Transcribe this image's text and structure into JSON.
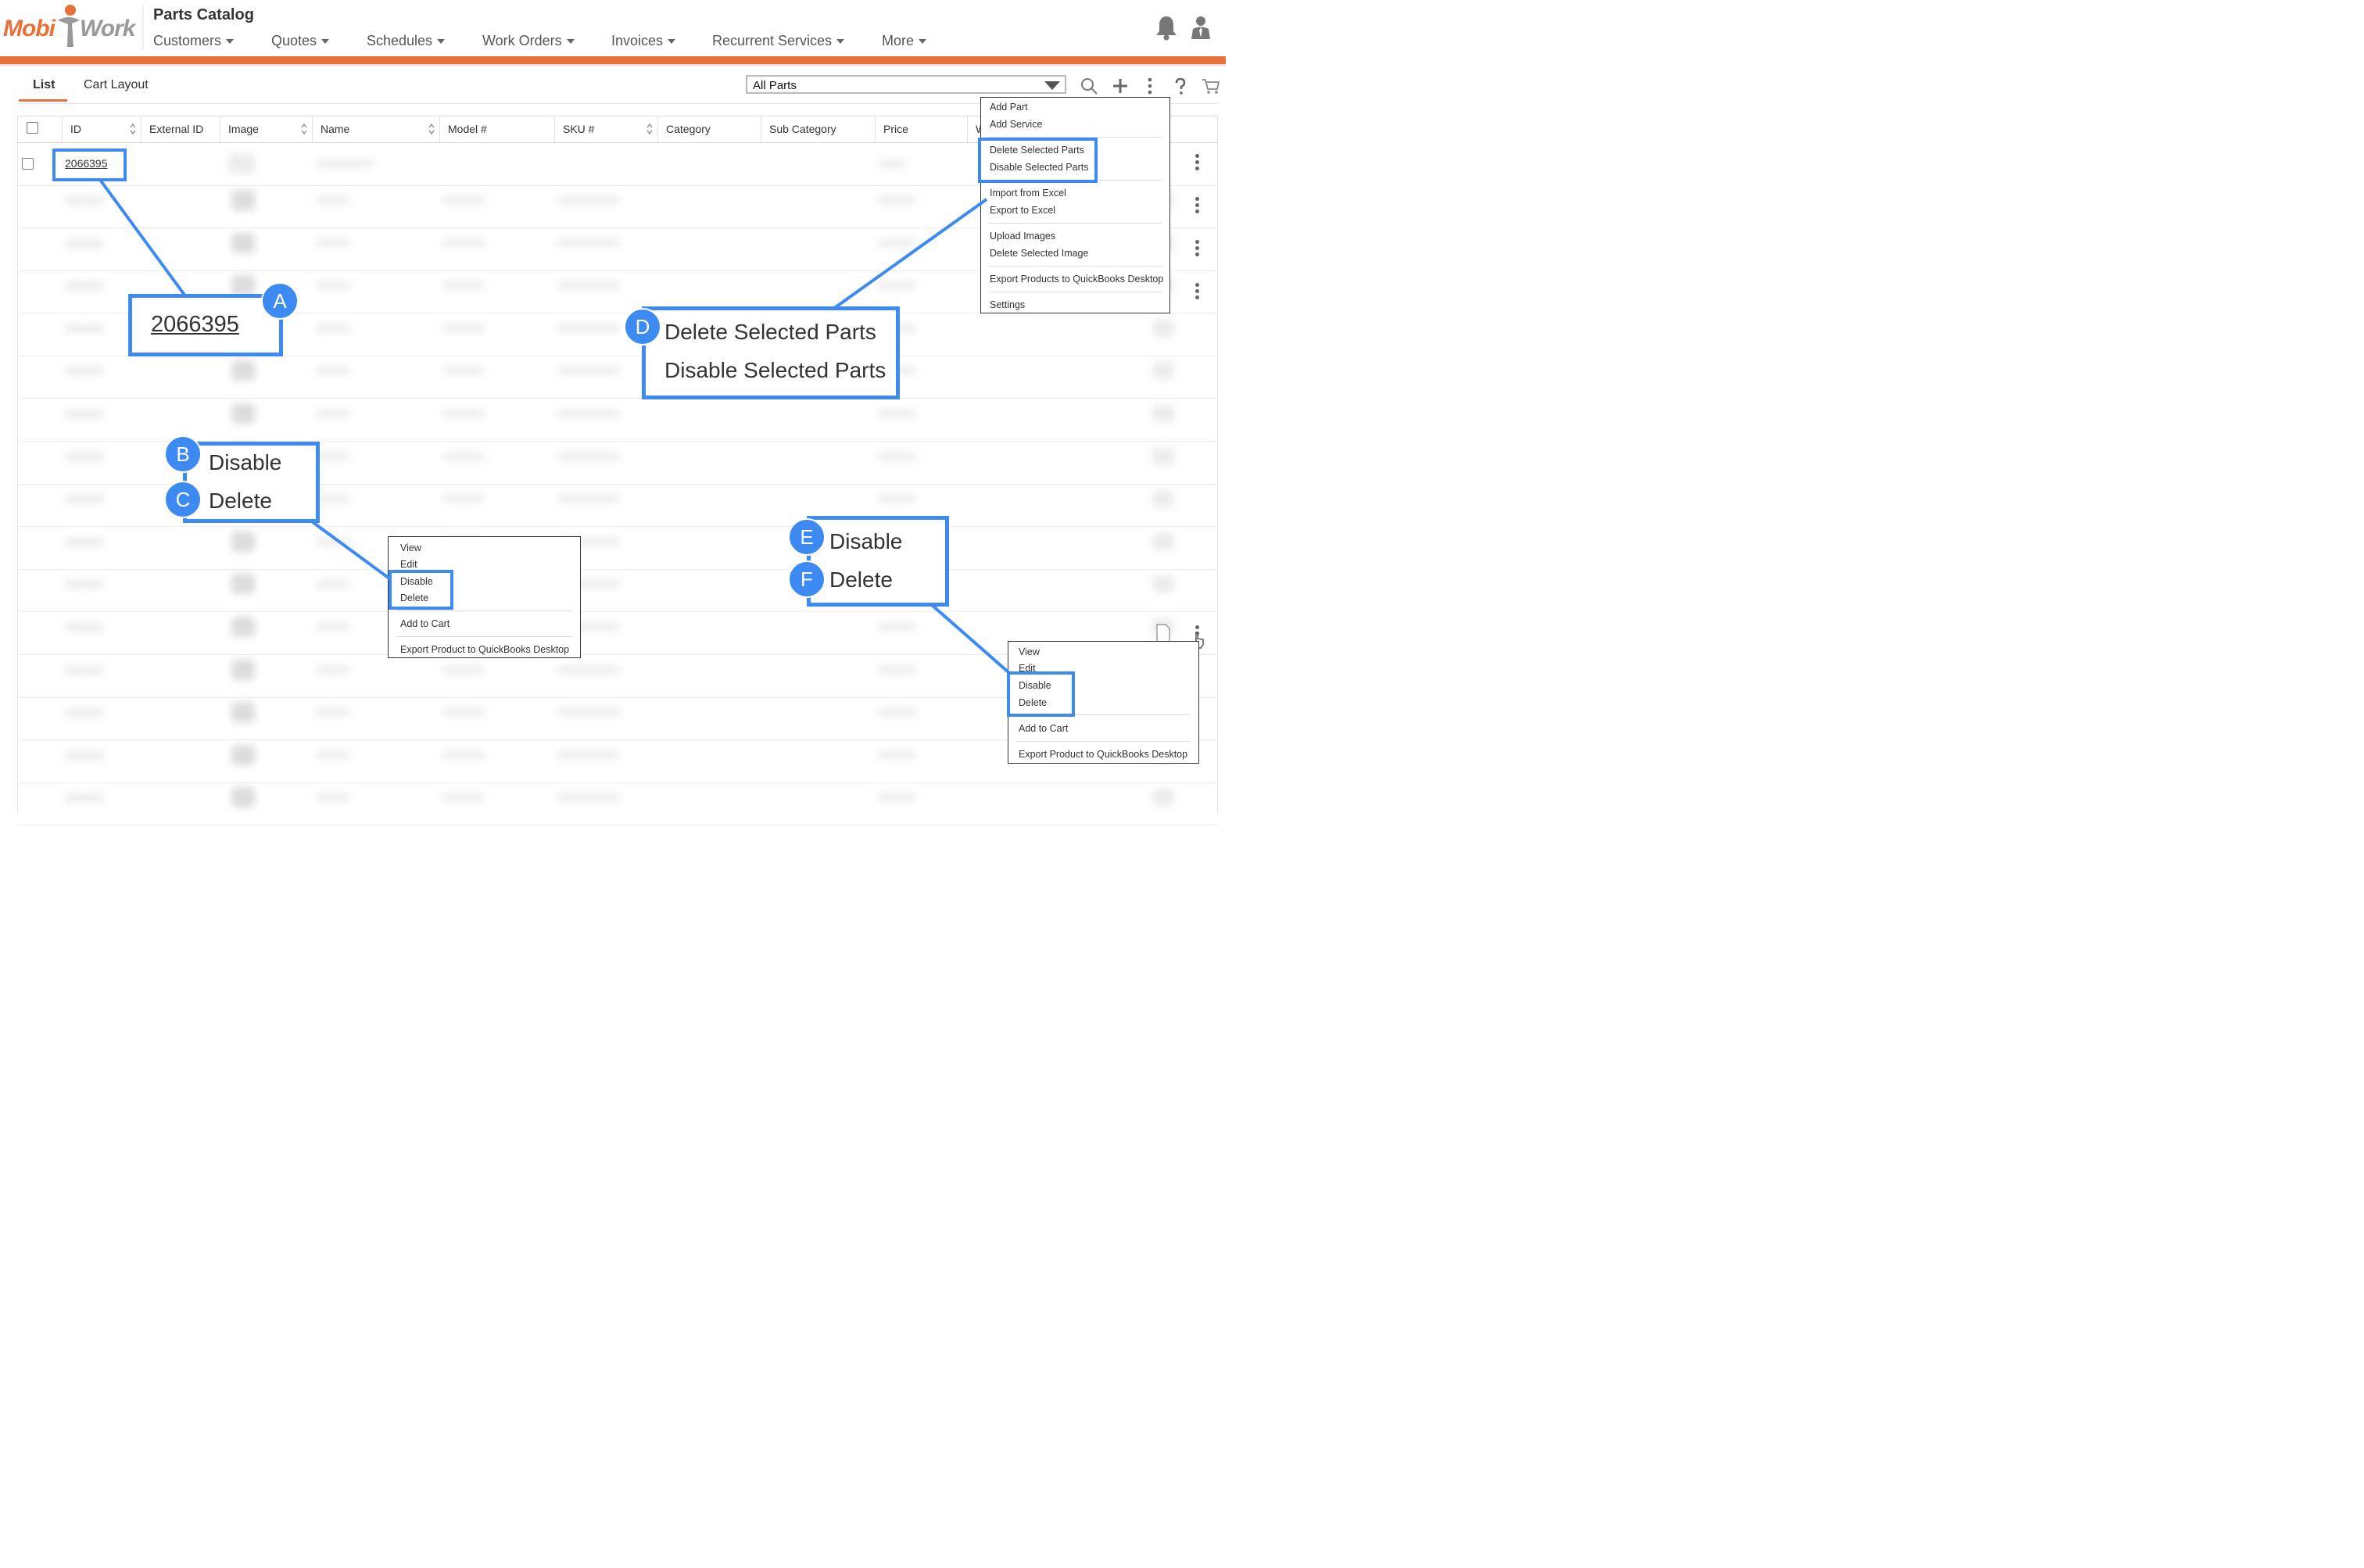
{
  "header": {
    "logo_left": "Mobi",
    "logo_right": "Work",
    "title": "Parts Catalog",
    "nav": [
      "Customers",
      "Quotes",
      "Schedules",
      "Work Orders",
      "Invoices",
      "Recurrent Services",
      "More"
    ],
    "icons": [
      "bell-icon",
      "user-icon"
    ]
  },
  "toolbar": {
    "tabs": [
      "List",
      "Cart Layout"
    ],
    "active_tab": "List",
    "filter_value": "All Parts",
    "icons": [
      "search-icon",
      "plus-icon",
      "kebab-icon",
      "help-icon",
      "cart-icon"
    ]
  },
  "table": {
    "columns": [
      "ID",
      "External ID",
      "Image",
      "Name",
      "Model #",
      "SKU #",
      "Category",
      "Sub Category",
      "Price",
      "W"
    ],
    "first_row_id": "2066395"
  },
  "toolbar_menu": {
    "items": [
      "Add Part",
      "Add Service",
      "Delete Selected Parts",
      "Disable Selected Parts",
      "Import from Excel",
      "Export to Excel",
      "Upload Images",
      "Delete Selected Image",
      "Export Products to QuickBooks Desktop",
      "Settings"
    ]
  },
  "row_menu": {
    "items": [
      "View",
      "Edit",
      "Disable",
      "Delete",
      "Add to Cart",
      "Export Product to QuickBooks Desktop"
    ]
  },
  "callouts": {
    "a": {
      "badge": "A",
      "text": "2066395"
    },
    "b": {
      "badge": "B",
      "text": "Disable"
    },
    "c": {
      "badge": "C",
      "text": "Delete"
    },
    "d": {
      "badge": "D",
      "line1": "Delete Selected Parts",
      "line2": "Disable Selected Parts"
    },
    "e": {
      "badge": "E",
      "text": "Disable"
    },
    "f": {
      "badge": "F",
      "text": "Delete"
    }
  },
  "colors": {
    "brand": "#e8703a",
    "highlight": "#3d8bf2"
  }
}
